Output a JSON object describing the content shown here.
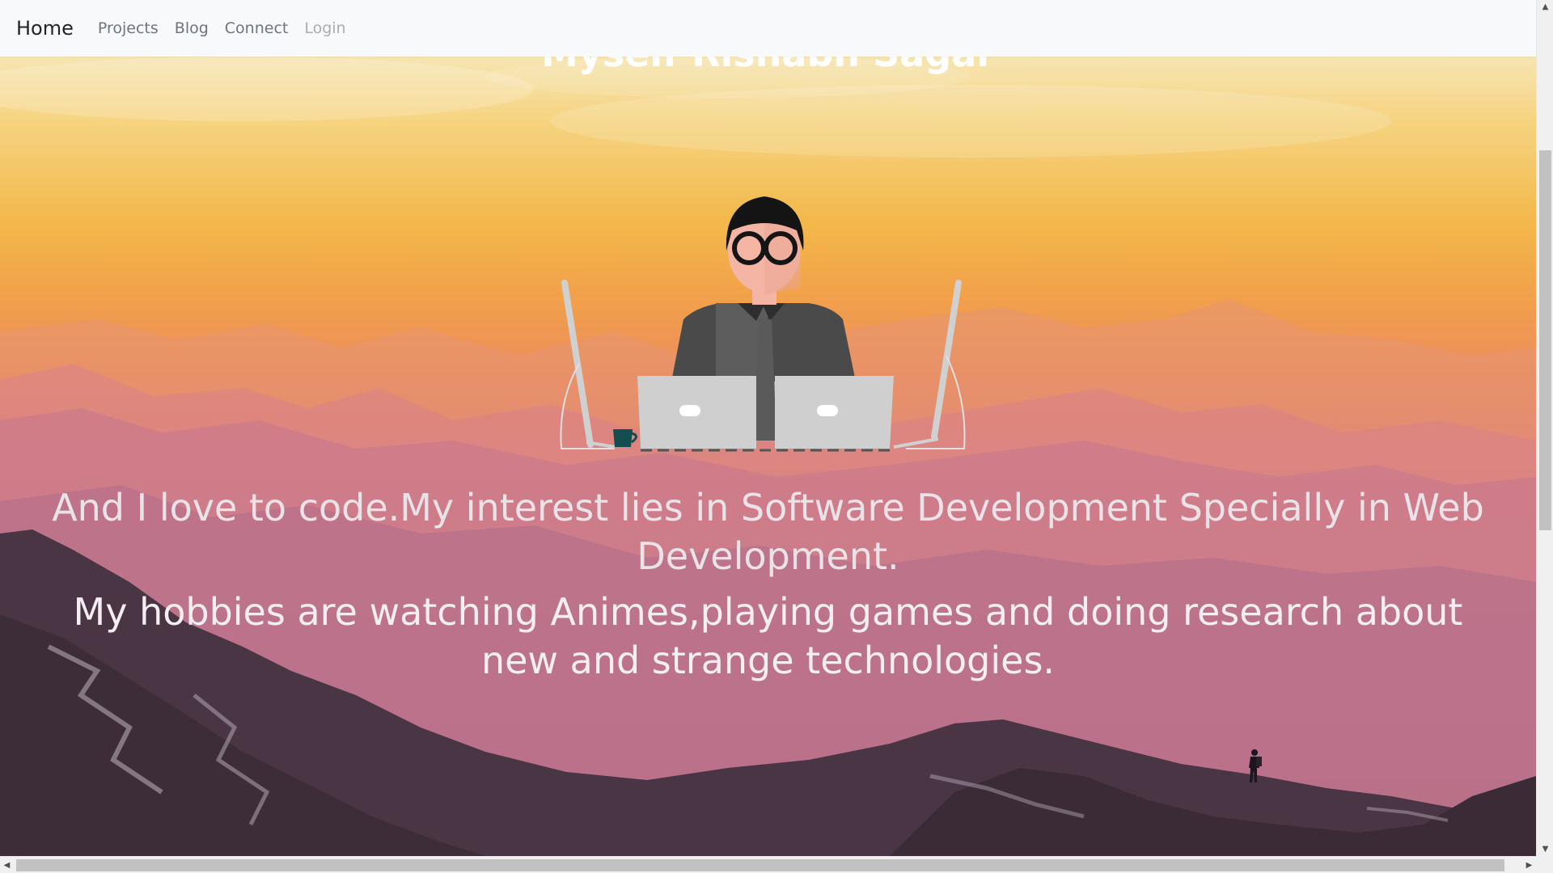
{
  "navbar": {
    "brand": "Home",
    "links": [
      {
        "label": "Projects",
        "disabled": false
      },
      {
        "label": "Blog",
        "disabled": false
      },
      {
        "label": "Connect",
        "disabled": false
      },
      {
        "label": "Login",
        "disabled": true
      }
    ]
  },
  "hero": {
    "partial_title": "Myself Rishabh Sagar",
    "bio_line_1": "And I love to code.My interest lies in Software Development Specially in Web Development.",
    "bio_line_2": "My hobbies are watching Animes,playing games and doing research about new and strange technologies."
  },
  "colors": {
    "navbar_bg": "#f8f9fa",
    "brand_text": "#212529",
    "nav_link": "#6c757d",
    "nav_link_disabled": "#a9adb1"
  },
  "icons": {
    "developer_illustration": "developer-at-laptops",
    "scroll_up": "arrow-up-icon",
    "scroll_down": "arrow-down-icon",
    "scroll_left": "arrow-left-icon",
    "scroll_right": "arrow-right-icon"
  }
}
